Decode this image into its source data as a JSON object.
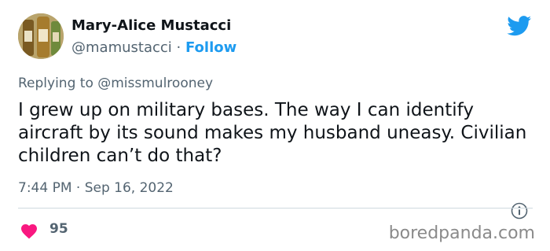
{
  "author": {
    "name": "Mary-Alice Mustacci",
    "handle": "@mamustacci",
    "separator": "·",
    "follow_label": "Follow"
  },
  "reply": {
    "prefix": "Replying to",
    "mention": "@missmulrooney"
  },
  "tweet": {
    "text": "I grew up on military bases. The way I can identify aircraft by its sound makes my husband uneasy. Civilian children can’t do that?"
  },
  "meta": {
    "time": "7:44 PM",
    "separator": "·",
    "date": "Sep 16, 2022"
  },
  "engagement": {
    "likes": "95"
  },
  "watermark": "boredpanda.com",
  "icons": {
    "brand": "twitter-bird-icon",
    "info": "info-icon",
    "like": "heart-icon"
  },
  "colors": {
    "accent": "#1d9bf0",
    "heart": "#f91880",
    "muted": "#536471",
    "text": "#0f1419"
  }
}
